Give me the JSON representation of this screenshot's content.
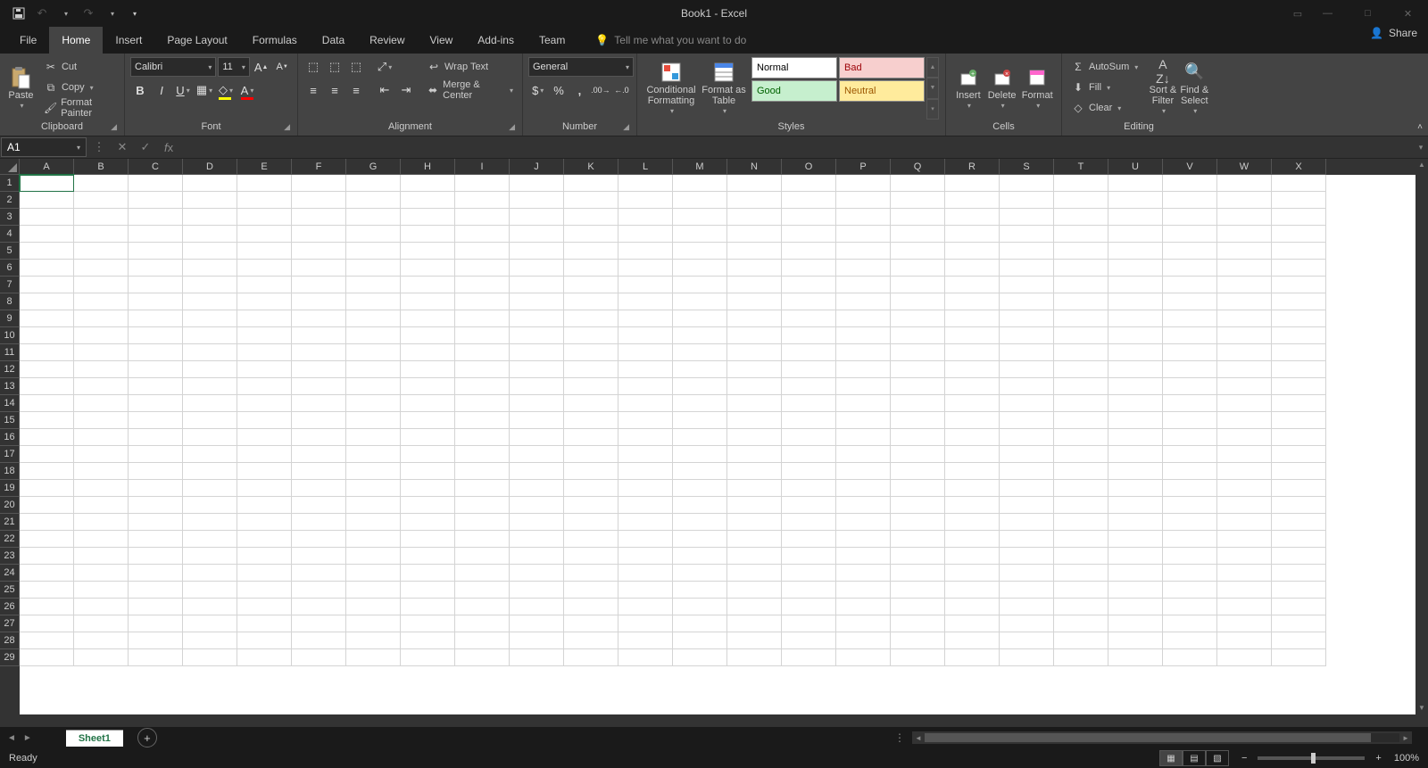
{
  "title": "Book1 - Excel",
  "tabs": [
    "File",
    "Home",
    "Insert",
    "Page Layout",
    "Formulas",
    "Data",
    "Review",
    "View",
    "Add-ins",
    "Team"
  ],
  "active_tab": "Home",
  "tellme_placeholder": "Tell me what you want to do",
  "share_label": "Share",
  "clipboard": {
    "label": "Clipboard",
    "paste": "Paste",
    "cut": "Cut",
    "copy": "Copy",
    "painter": "Format Painter"
  },
  "font": {
    "label": "Font",
    "name": "Calibri",
    "size": "11"
  },
  "alignment": {
    "label": "Alignment",
    "wrap": "Wrap Text",
    "merge": "Merge & Center"
  },
  "number": {
    "label": "Number",
    "format": "General"
  },
  "styles": {
    "label": "Styles",
    "cond": "Conditional Formatting",
    "table": "Format as Table",
    "cells": {
      "normal": "Normal",
      "bad": "Bad",
      "good": "Good",
      "neutral": "Neutral"
    }
  },
  "cells_group": {
    "label": "Cells",
    "insert": "Insert",
    "delete": "Delete",
    "format": "Format"
  },
  "editing": {
    "label": "Editing",
    "autosum": "AutoSum",
    "fill": "Fill",
    "clear": "Clear",
    "sort": "Sort & Filter",
    "find": "Find & Select"
  },
  "namebox": "A1",
  "columns": [
    "A",
    "B",
    "C",
    "D",
    "E",
    "F",
    "G",
    "H",
    "I",
    "J",
    "K",
    "L",
    "M",
    "N",
    "O",
    "P",
    "Q",
    "R",
    "S",
    "T",
    "U",
    "V",
    "W",
    "X"
  ],
  "rows": [
    1,
    2,
    3,
    4,
    5,
    6,
    7,
    8,
    9,
    10,
    11,
    12,
    13,
    14,
    15,
    16,
    17,
    18,
    19,
    20,
    21,
    22,
    23,
    24,
    25,
    26,
    27,
    28,
    29
  ],
  "sheet": "Sheet1",
  "status": "Ready",
  "zoom": "100%",
  "colors": {
    "normal_bg": "#ffffff",
    "bad_bg": "#f7cfce",
    "bad_fg": "#9c0006",
    "good_bg": "#c6efce",
    "good_fg": "#006100",
    "neutral_bg": "#ffeb9c",
    "neutral_fg": "#9c5700"
  }
}
